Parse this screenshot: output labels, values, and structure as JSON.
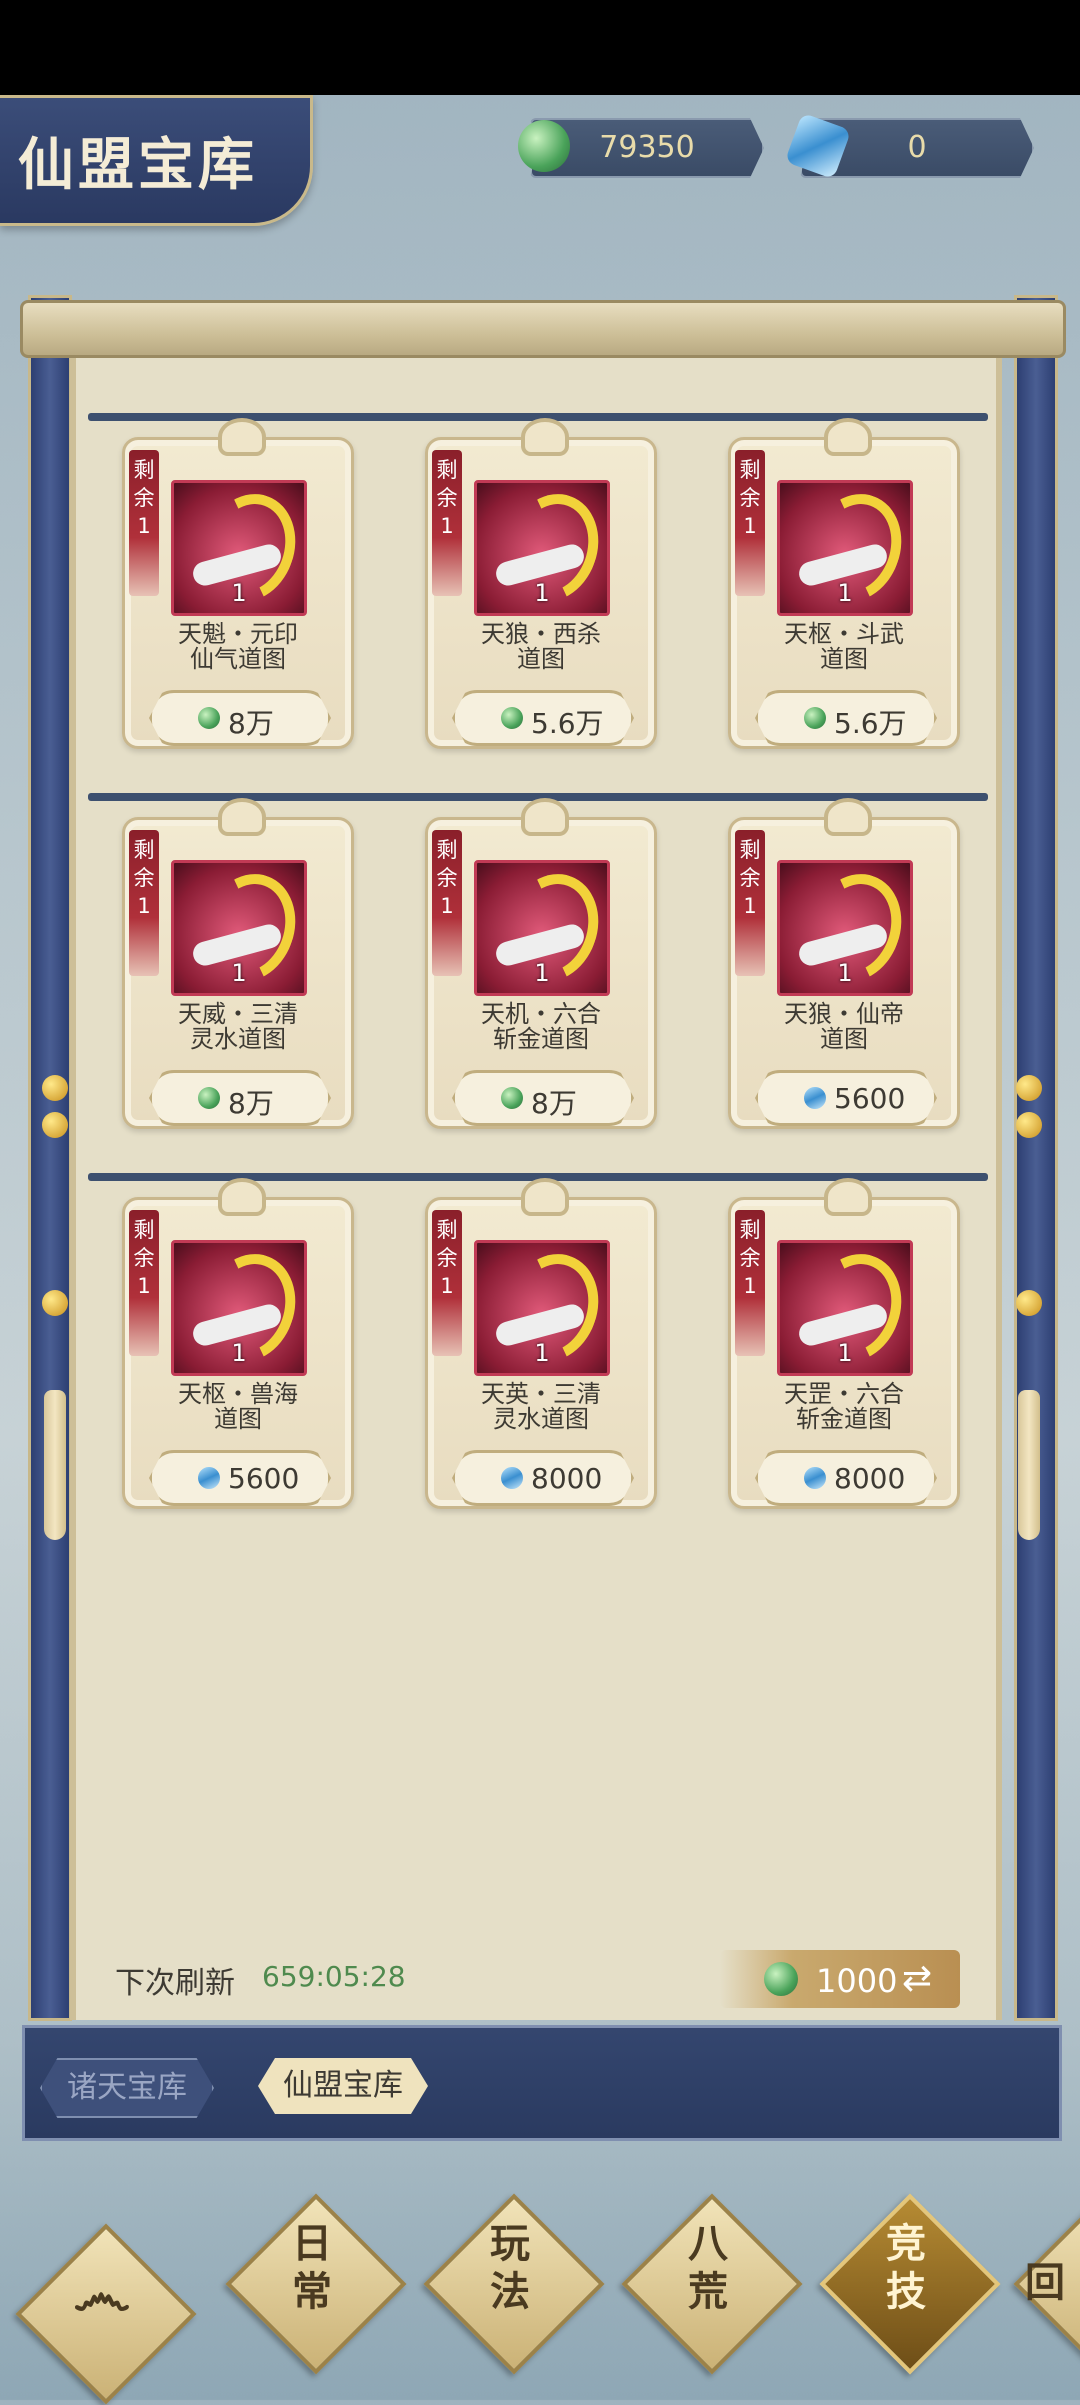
{
  "header": {
    "title": "仙盟宝库",
    "currencies": [
      {
        "icon": "jade-icon",
        "value": "79350"
      },
      {
        "icon": "crystal-icon",
        "value": "0"
      }
    ]
  },
  "shop": {
    "remain_label": "剩余",
    "items": [
      {
        "remain": "1",
        "count": "1",
        "name_line1": "天魁・元印",
        "name_line2": "仙气道图",
        "price_icon": "jade-icon",
        "price": "8万"
      },
      {
        "remain": "1",
        "count": "1",
        "name_line1": "天狼・西杀",
        "name_line2": "道图",
        "price_icon": "jade-icon",
        "price": "5.6万"
      },
      {
        "remain": "1",
        "count": "1",
        "name_line1": "天枢・斗武",
        "name_line2": "道图",
        "price_icon": "jade-icon",
        "price": "5.6万"
      },
      {
        "remain": "1",
        "count": "1",
        "name_line1": "天威・三清",
        "name_line2": "灵水道图",
        "price_icon": "jade-icon",
        "price": "8万"
      },
      {
        "remain": "1",
        "count": "1",
        "name_line1": "天机・六合",
        "name_line2": "斩金道图",
        "price_icon": "jade-icon",
        "price": "8万"
      },
      {
        "remain": "1",
        "count": "1",
        "name_line1": "天狼・仙帝",
        "name_line2": "道图",
        "price_icon": "crystal-icon",
        "price": "5600"
      },
      {
        "remain": "1",
        "count": "1",
        "name_line1": "天枢・兽海",
        "name_line2": "道图",
        "price_icon": "crystal-icon",
        "price": "5600"
      },
      {
        "remain": "1",
        "count": "1",
        "name_line1": "天英・三清",
        "name_line2": "灵水道图",
        "price_icon": "crystal-icon",
        "price": "8000"
      },
      {
        "remain": "1",
        "count": "1",
        "name_line1": "天罡・六合",
        "name_line2": "斩金道图",
        "price_icon": "crystal-icon",
        "price": "8000"
      }
    ]
  },
  "refresh": {
    "label": "下次刷新",
    "time": "659:05:28",
    "cost": "1000"
  },
  "tabs": [
    {
      "label": "诸天宝库",
      "active": false
    },
    {
      "label": "仙盟宝库",
      "active": true
    }
  ],
  "bottom_nav": [
    {
      "label": "日\n常",
      "active": false
    },
    {
      "label": "玩\n法",
      "active": false
    },
    {
      "label": "八\n荒",
      "active": false
    },
    {
      "label": "竞\n技",
      "active": true
    },
    {
      "label": "回",
      "active": false
    }
  ],
  "colors": {
    "panel_blue": "#2d3f72",
    "paper": "#e5dfc8",
    "time_green": "#4f8a4e",
    "remain_red": "#8a1f2a"
  }
}
